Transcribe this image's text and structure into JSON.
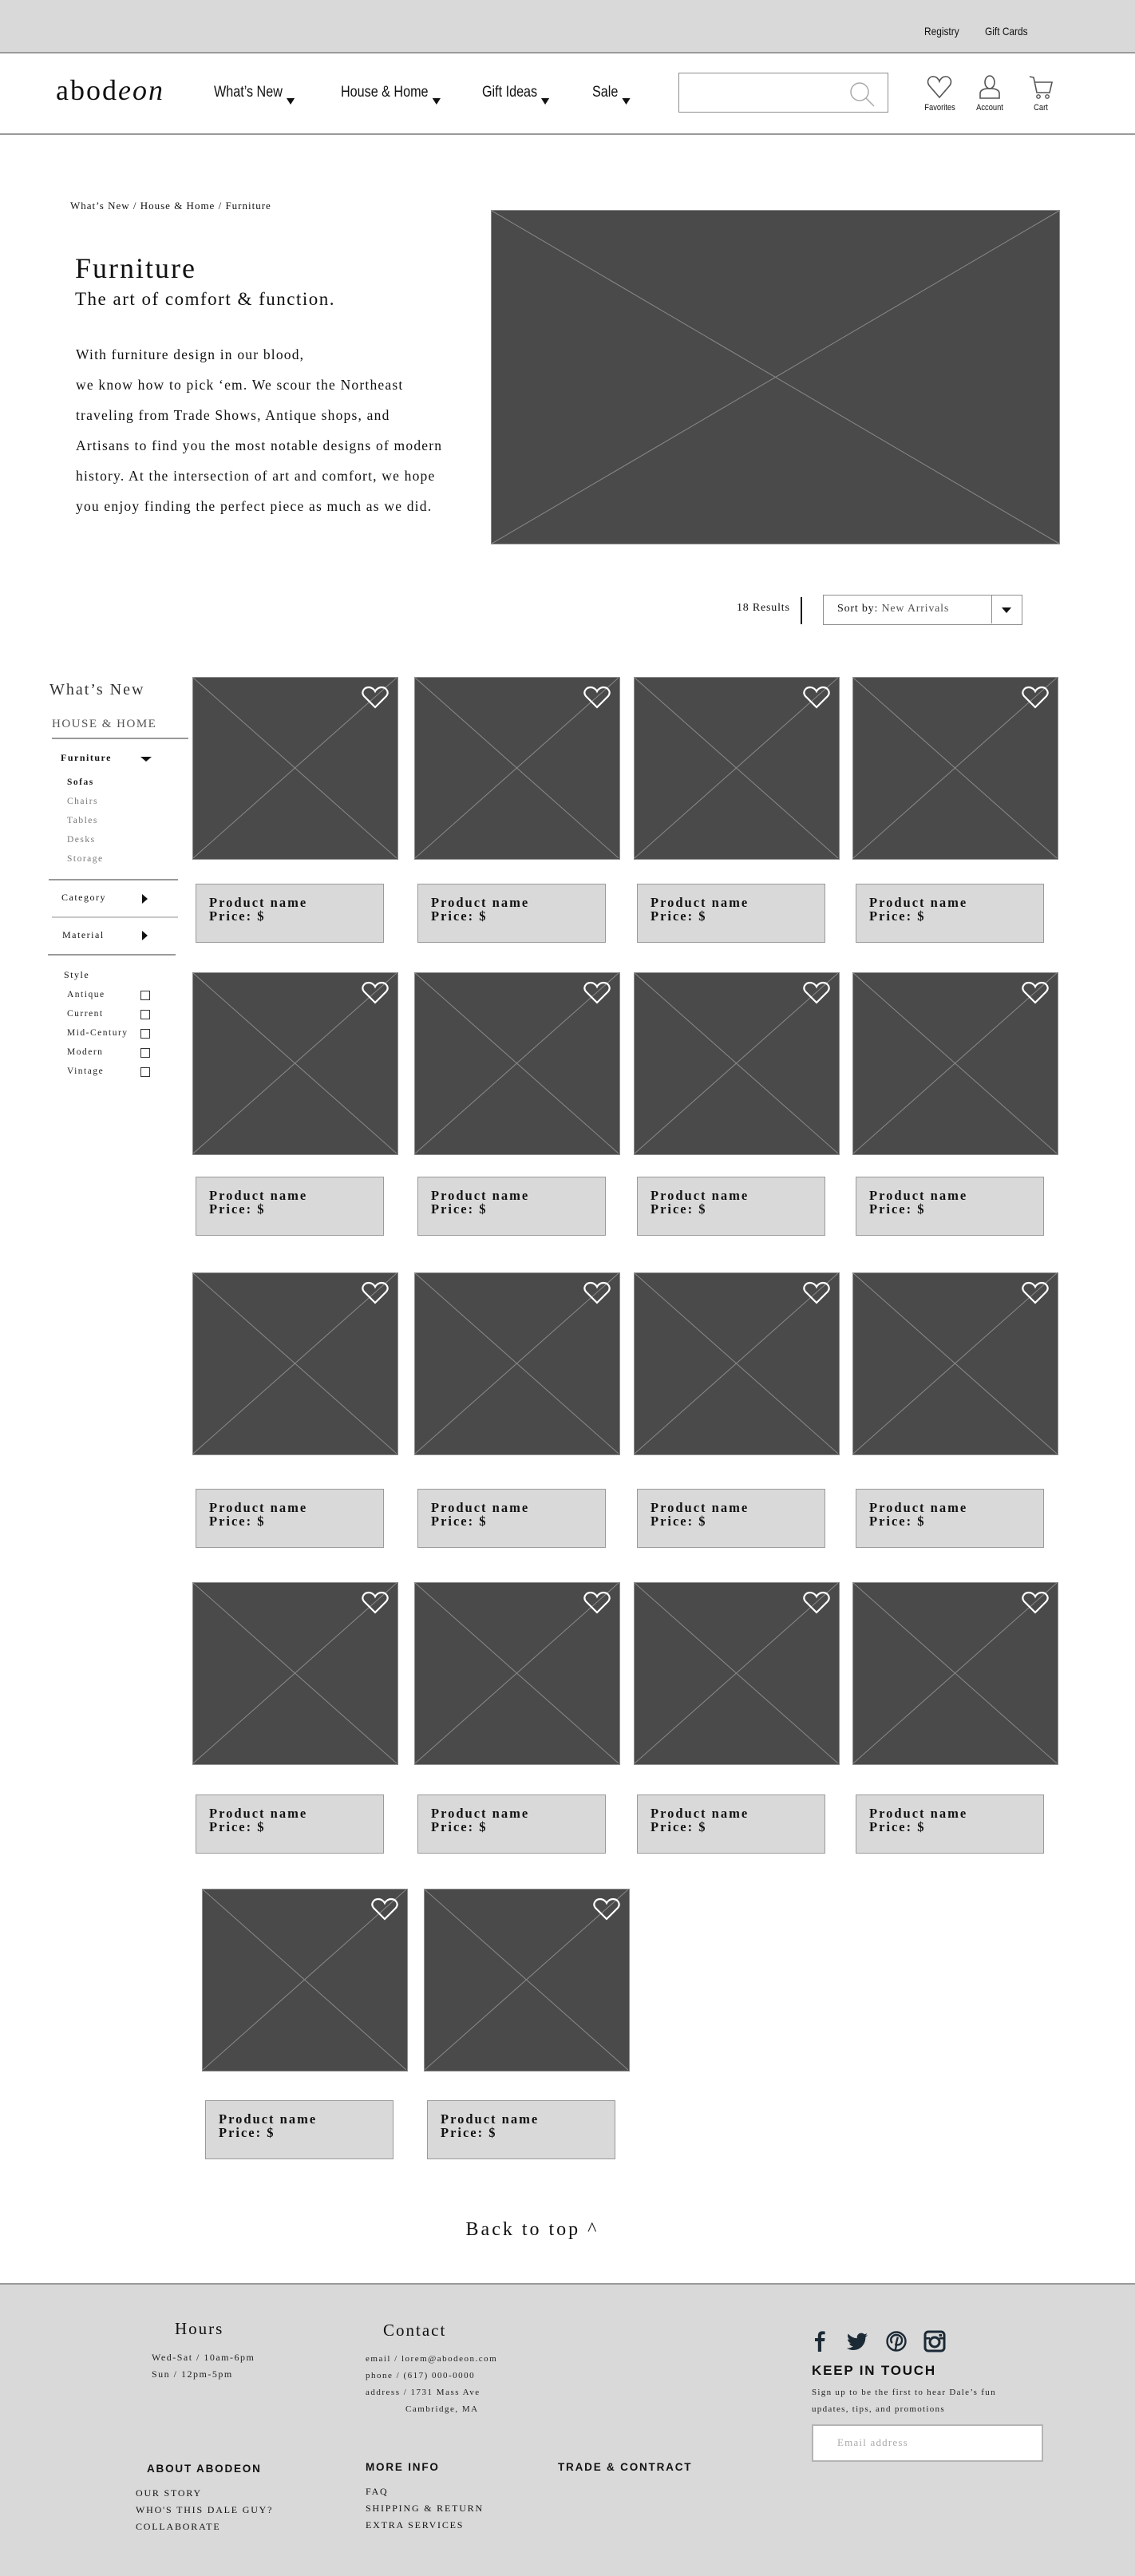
{
  "topbar": {
    "links": [
      "Registry",
      "Gift Cards"
    ]
  },
  "header": {
    "logo": {
      "plain": "abod",
      "italic": "eon"
    },
    "nav": [
      "What’s New",
      "House & Home",
      "Gift Ideas",
      "Sale"
    ],
    "search": {
      "value": "",
      "placeholder": ""
    },
    "icons": [
      {
        "icon": "heart-icon",
        "label": "Favorites"
      },
      {
        "icon": "account-icon",
        "label": "Account"
      },
      {
        "icon": "cart-icon",
        "label": "Cart"
      }
    ]
  },
  "breadcrumb": "What’s New / House & Home / Furniture",
  "intro": {
    "title": "Furniture",
    "subtitle": "The art of comfort & function.",
    "lines": [
      "With furniture design in our blood,",
      "we know how to pick ‘em. We scour the Northeast",
      "traveling from Trade Shows, Antique shops, and",
      "Artisans to find you the most notable designs of modern",
      "history. At the intersection of art and comfort, we hope",
      "you enjoy finding the perfect piece as much as we did."
    ]
  },
  "toolbar": {
    "results": "18 Results",
    "sort_label": "Sort by:",
    "sort_value": "New Arrivals"
  },
  "sidebar": {
    "heading": "What’s New",
    "section": "HOUSE & HOME",
    "current": "Furniture",
    "subitems": [
      "Sofas",
      "Chairs",
      "Tables",
      "Desks",
      "Storage"
    ],
    "filters": [
      "Category",
      "Material"
    ],
    "style_label": "Style",
    "styles": [
      {
        "label": "Antique",
        "checked": false
      },
      {
        "label": "Current",
        "checked": false
      },
      {
        "label": "Mid-Century",
        "checked": false
      },
      {
        "label": "Modern",
        "checked": false
      },
      {
        "label": "Vintage",
        "checked": false
      }
    ]
  },
  "products": [
    {
      "name": "Product name",
      "price": "Price: $"
    },
    {
      "name": "Product name",
      "price": "Price: $"
    },
    {
      "name": "Product name",
      "price": "Price: $"
    },
    {
      "name": "Product name",
      "price": "Price: $"
    },
    {
      "name": "Product name",
      "price": "Price: $"
    },
    {
      "name": "Product name",
      "price": "Price: $"
    },
    {
      "name": "Product name",
      "price": "Price: $"
    },
    {
      "name": "Product name",
      "price": "Price: $"
    },
    {
      "name": "Product name",
      "price": "Price: $"
    },
    {
      "name": "Product name",
      "price": "Price: $"
    },
    {
      "name": "Product name",
      "price": "Price: $"
    },
    {
      "name": "Product name",
      "price": "Price: $"
    },
    {
      "name": "Product name",
      "price": "Price: $"
    },
    {
      "name": "Product name",
      "price": "Price: $"
    },
    {
      "name": "Product name",
      "price": "Price: $"
    },
    {
      "name": "Product name",
      "price": "Price: $"
    },
    {
      "name": "Product name",
      "price": "Price: $"
    },
    {
      "name": "Product name",
      "price": "Price: $"
    }
  ],
  "back_to_top": "Back to top ^",
  "footer": {
    "hours": {
      "title": "Hours",
      "lines": [
        "Wed-Sat / 10am-6pm",
        "Sun / 12pm-5pm"
      ]
    },
    "contact": {
      "title": "Contact",
      "email": "email / lorem@abodeon.com",
      "phone": "phone / (617) 000-0000",
      "address": "address / 1731 Mass Ave",
      "address2": "Cambridge, MA"
    },
    "about": {
      "title": "ABOUT ABODEON",
      "links": [
        "OUR STORY",
        "WHO'S THIS DALE GUY?",
        "COLLABORATE"
      ]
    },
    "more": {
      "title": "MORE INFO",
      "links": [
        "FAQ",
        "SHIPPING & RETURN",
        "EXTRA SERVICES"
      ]
    },
    "trade": "TRADE & CONTRACT",
    "social": [
      "facebook-icon",
      "twitter-icon",
      "pinterest-icon",
      "instagram-icon"
    ],
    "newsletter": {
      "title": "KEEP IN TOUCH",
      "lines": [
        "Sign up to be the first to hear Dale’s fun",
        "updates, tips, and promotions"
      ],
      "placeholder": "Email address",
      "value": ""
    }
  },
  "colors": {
    "placeholder_image": "#4a4a4a",
    "panel_gray": "#d9d9d9",
    "border_gray": "#9a9a9a",
    "social_icon": "#1c2a36"
  }
}
